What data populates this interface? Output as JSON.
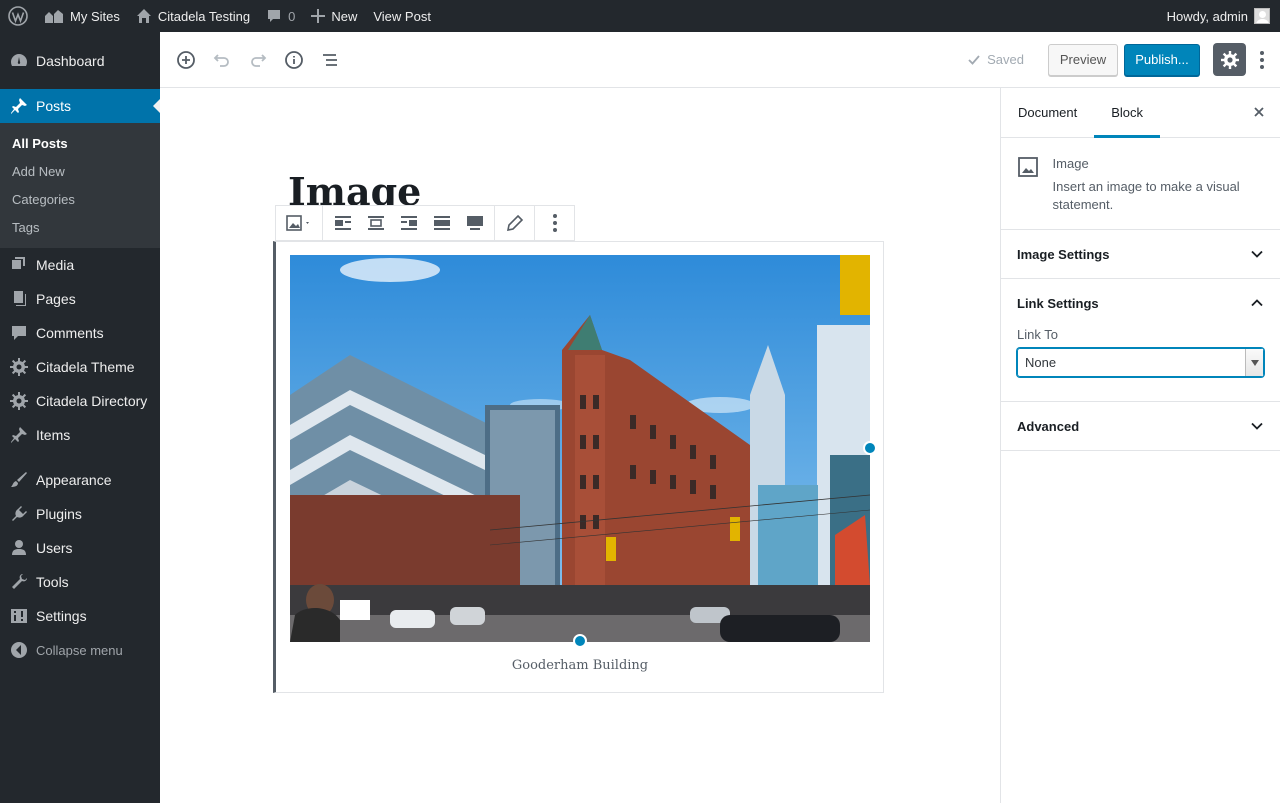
{
  "admin_bar": {
    "my_sites": "My Sites",
    "site_name": "Citadela Testing",
    "comments_count": "0",
    "new_label": "New",
    "view_post": "View Post",
    "greeting": "Howdy, admin"
  },
  "menu": {
    "dashboard": "Dashboard",
    "posts": "Posts",
    "posts_sub": [
      "All Posts",
      "Add New",
      "Categories",
      "Tags"
    ],
    "media": "Media",
    "pages": "Pages",
    "comments": "Comments",
    "citadela_theme": "Citadela Theme",
    "citadela_directory": "Citadela Directory",
    "items": "Items",
    "appearance": "Appearance",
    "plugins": "Plugins",
    "users": "Users",
    "tools": "Tools",
    "settings": "Settings",
    "collapse": "Collapse menu"
  },
  "header": {
    "saved": "Saved",
    "preview": "Preview",
    "publish": "Publish..."
  },
  "post": {
    "title": "Image",
    "caption": "Gooderham Building"
  },
  "sidebar": {
    "tabs": [
      "Document",
      "Block"
    ],
    "active_tab": "Block",
    "block_name": "Image",
    "block_description": "Insert an image to make a visual statement.",
    "panels": {
      "image_settings": "Image Settings",
      "link_settings": "Link Settings",
      "link_to_label": "Link To",
      "link_to_value": "None",
      "advanced": "Advanced"
    }
  },
  "colors": {
    "admin_dark": "#23282d",
    "accent_blue": "#0085ba",
    "menu_current": "#0073aa"
  }
}
